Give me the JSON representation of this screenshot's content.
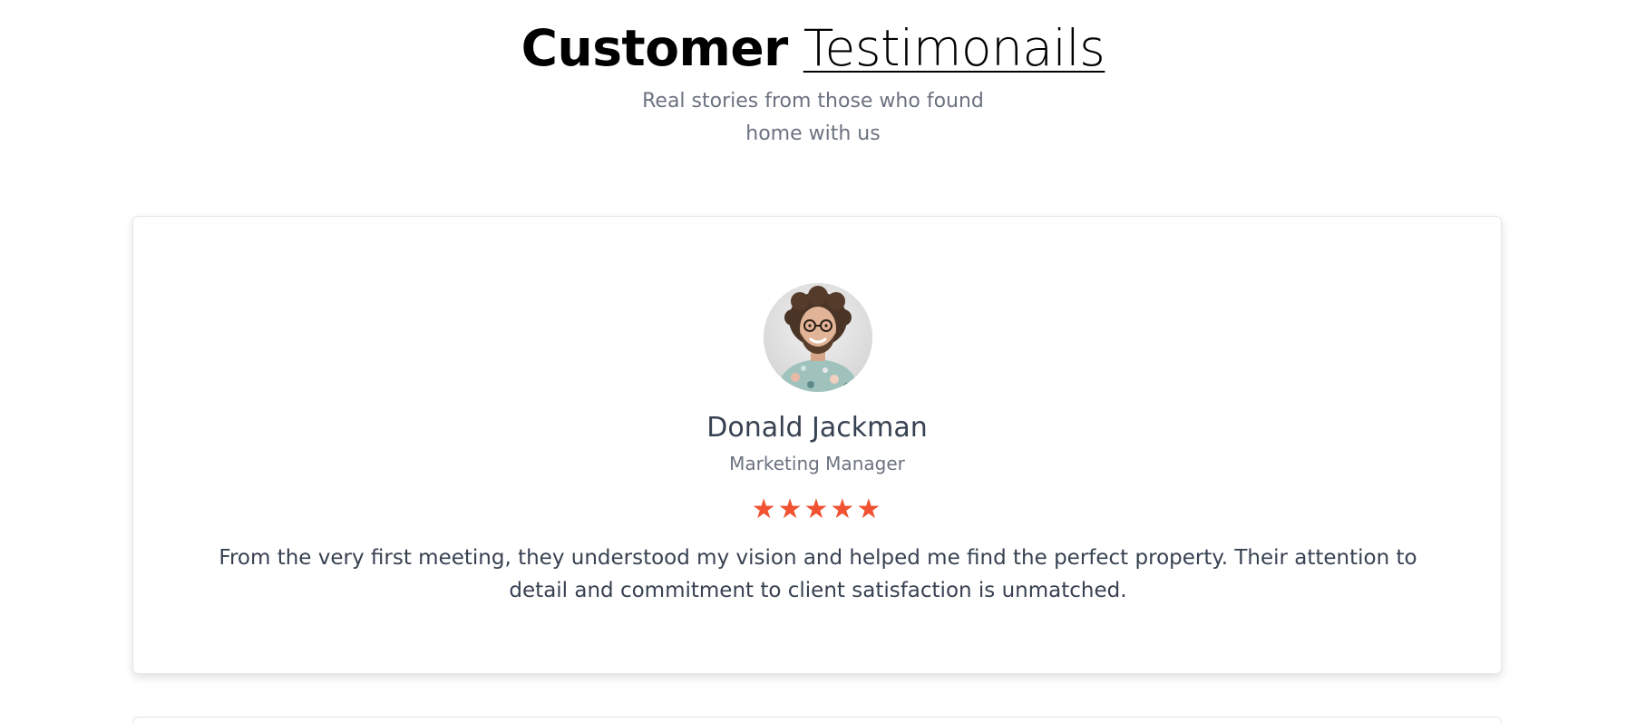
{
  "header": {
    "title_bold": "Customer",
    "title_light": "Testimonails",
    "subtitle_line1": "Real stories from those who found",
    "subtitle_line2": "home with us"
  },
  "testimonial": {
    "name": "Donald Jackman",
    "role": "Marketing Manager",
    "stars": "★★★★★",
    "rating": 5,
    "rating_max": 5,
    "quote": "From the very first meeting, they understood my vision and helped me find the perfect property. Their attention to detail and commitment to client satisfaction is unmatched."
  },
  "colors": {
    "star": "#f05232",
    "name": "#374151",
    "muted": "#6b7280"
  }
}
